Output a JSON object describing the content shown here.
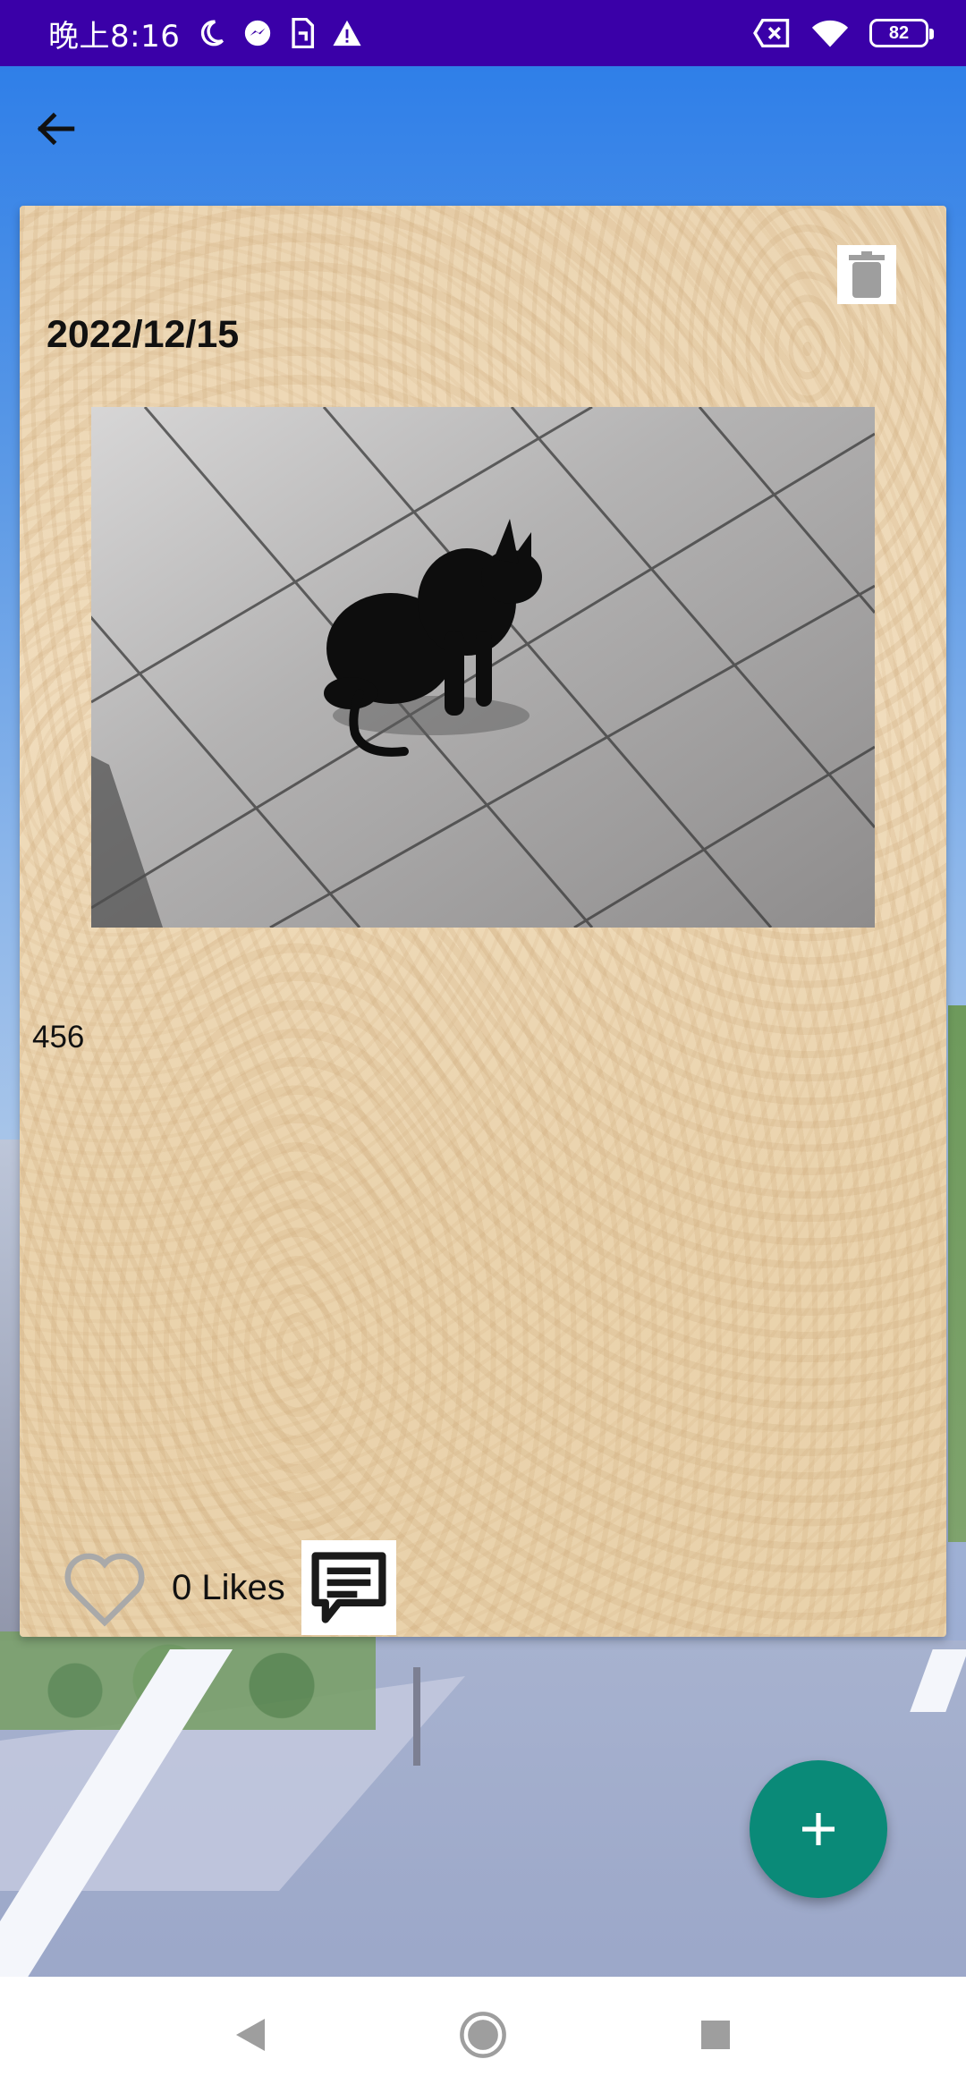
{
  "status_bar": {
    "time": "晚上8:16",
    "battery_level": "82",
    "icons": [
      "moon-icon",
      "messenger-icon",
      "sim-icon",
      "warning-icon",
      "no-sim-icon",
      "wifi-icon",
      "battery-icon"
    ]
  },
  "app_bar": {
    "back_icon": "arrow-left-icon"
  },
  "post": {
    "date": "2022/12/15",
    "text": "456",
    "likes_label": "0 Likes",
    "photo_subject": "black cat on tiled floor"
  },
  "colors": {
    "status_bar": "#3a00a8",
    "fab": "#0a8a78",
    "card_wood": "#ecd6b3"
  },
  "fab": {
    "icon": "plus-icon"
  },
  "nav": {
    "back_icon": "triangle-back-icon",
    "home_icon": "circle-home-icon",
    "recents_icon": "square-recents-icon"
  }
}
